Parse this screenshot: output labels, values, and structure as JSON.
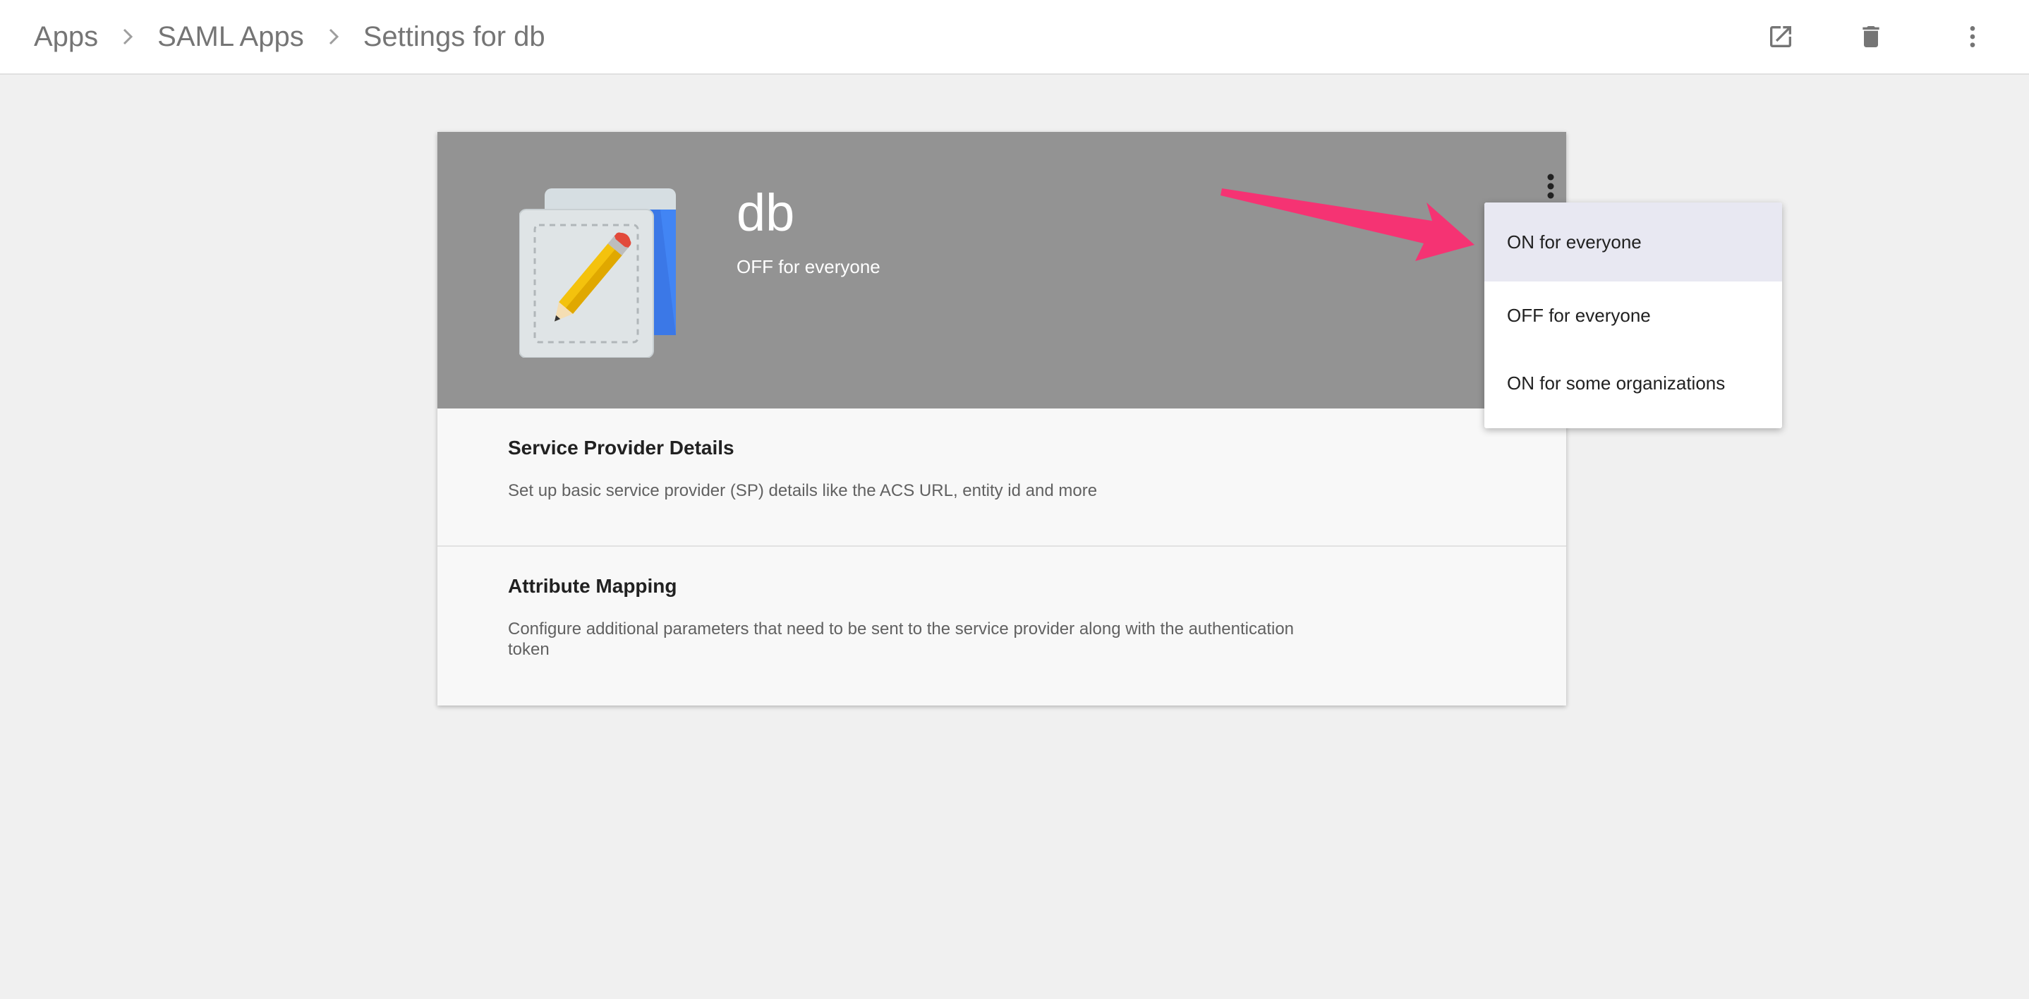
{
  "breadcrumb": {
    "items": [
      "Apps",
      "SAML Apps",
      "Settings for db"
    ]
  },
  "toolbar": {
    "icons": [
      "open-in-new-icon",
      "delete-icon",
      "more-vert-icon"
    ]
  },
  "app": {
    "name": "db",
    "status": "OFF for everyone"
  },
  "sections": [
    {
      "title": "Service Provider Details",
      "description": "Set up basic service provider (SP) details like the ACS URL, entity id and more"
    },
    {
      "title": "Attribute Mapping",
      "description": "Configure additional parameters that need to be sent to the service provider along with the authentication token"
    }
  ],
  "status_menu": {
    "options": [
      "ON for everyone",
      "OFF for everyone",
      "ON for some organizations"
    ],
    "highlighted": "ON for everyone"
  },
  "colors": {
    "header_bg": "#939393",
    "page_bg": "#f0f0f0",
    "annotation_arrow": "#f53373",
    "highlight_bg": "#e8e8f2"
  }
}
